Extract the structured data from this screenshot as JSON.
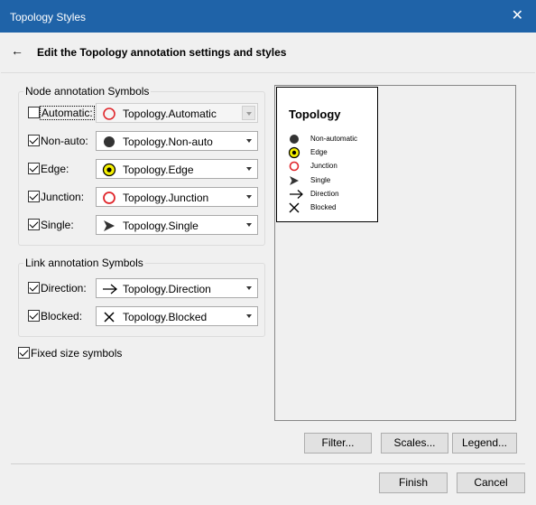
{
  "window": {
    "title": "Topology Styles",
    "close_glyph": "✕"
  },
  "header": {
    "back_glyph": "←",
    "text": "Edit the Topology annotation settings and styles"
  },
  "node_group": {
    "title": "Node annotation Symbols",
    "rows": [
      {
        "label": "Automatic:",
        "checked": false,
        "value": "Topology.Automatic",
        "symbol": "red-ring-icon",
        "enabled": false
      },
      {
        "label": "Non-auto:",
        "checked": true,
        "value": "Topology.Non-auto",
        "symbol": "black-dot-icon",
        "enabled": true
      },
      {
        "label": "Edge:",
        "checked": true,
        "value": "Topology.Edge",
        "symbol": "yellow-ring-dot-icon",
        "enabled": true
      },
      {
        "label": "Junction:",
        "checked": true,
        "value": "Topology.Junction",
        "symbol": "red-ring-icon",
        "enabled": true
      },
      {
        "label": "Single:",
        "checked": true,
        "value": "Topology.Single",
        "symbol": "arrowhead-icon",
        "enabled": true
      }
    ]
  },
  "link_group": {
    "title": "Link annotation Symbols",
    "rows": [
      {
        "label": "Direction:",
        "checked": true,
        "value": "Topology.Direction",
        "symbol": "arrow-right-icon"
      },
      {
        "label": "Blocked:",
        "checked": true,
        "value": "Topology.Blocked",
        "symbol": "x-cross-icon"
      }
    ]
  },
  "fixed_size": {
    "label": "Fixed size symbols",
    "checked": true
  },
  "preview": {
    "title": "Topology",
    "items": [
      {
        "label": "Non-automatic",
        "symbol": "black-dot-icon"
      },
      {
        "label": "Edge",
        "symbol": "yellow-ring-dot-icon"
      },
      {
        "label": "Junction",
        "symbol": "red-ring-icon"
      },
      {
        "label": "Single",
        "symbol": "arrowhead-icon"
      },
      {
        "label": "Direction",
        "symbol": "arrow-right-icon"
      },
      {
        "label": "Blocked",
        "symbol": "x-cross-icon"
      }
    ]
  },
  "buttons": {
    "filter": "Filter...",
    "scales": "Scales...",
    "legend": "Legend...",
    "finish": "Finish",
    "cancel": "Cancel"
  },
  "colors": {
    "titlebar": "#1f63a8",
    "ring_red": "#e0262b",
    "ring_yellow": "#f5f000"
  }
}
